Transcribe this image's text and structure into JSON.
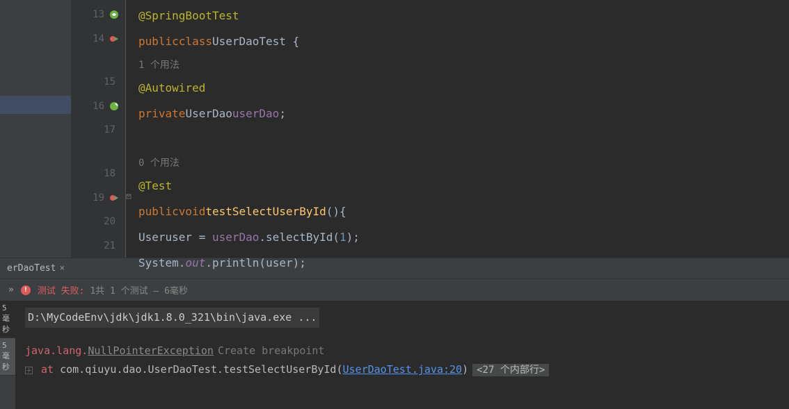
{
  "editor": {
    "lines": [
      {
        "num": "13",
        "icon": "spring"
      },
      {
        "num": "14",
        "icon": "run"
      },
      {
        "num": "15",
        "icon": ""
      },
      {
        "num": "16",
        "icon": "bean"
      },
      {
        "num": "17",
        "icon": ""
      },
      {
        "num": "18",
        "icon": ""
      },
      {
        "num": "19",
        "icon": "run"
      },
      {
        "num": "20",
        "icon": ""
      },
      {
        "num": "21",
        "icon": ""
      }
    ],
    "code": {
      "l13_annotation": "@SpringBootTest",
      "l14_public": "public",
      "l14_class": "class",
      "l14_name": "UserDaoTest",
      "l14_brace": " {",
      "l14a_hint": "1 个用法",
      "l15_annotation": "@Autowired",
      "l16_private": "private",
      "l16_type": "UserDao",
      "l16_field": "userDao",
      "l16_semi": ";",
      "l17a_hint": "0 个用法",
      "l18_annotation": "@Test",
      "l19_public": "public",
      "l19_void": "void",
      "l19_method": "testSelectUserById",
      "l19_parens": "(){",
      "l20_type": "User",
      "l20_var": "user",
      "l20_eq": " = ",
      "l20_field": "userDao",
      "l20_dot": ".",
      "l20_method": "selectById",
      "l20_open": "(",
      "l20_num": "1",
      "l20_close": ");",
      "l21_sys": "System",
      "l21_dot1": ".",
      "l21_out": "out",
      "l21_dot2": ".",
      "l21_println": "println",
      "l21_open": "(",
      "l21_var": "user",
      "l21_close": ");"
    }
  },
  "tab": {
    "name": "erDaoTest",
    "close": "×"
  },
  "status": {
    "chevron": "»",
    "error_label": "测试 失败:",
    "detail": "1共 1 个测试 – 6毫秒"
  },
  "time_tabs": {
    "t1": "5毫秒",
    "t2": "5毫秒"
  },
  "console": {
    "cmd": "D:\\MyCodeEnv\\jdk\\jdk1.8.0_321\\bin\\java.exe ...",
    "exception_pkg": "java.lang.",
    "exception_name": "NullPointerException",
    "breakpoint": "Create breakpoint",
    "at": "at",
    "stack_class": " com.qiuyu.dao.UserDaoTest.testSelectUserById",
    "stack_open": "(",
    "stack_link": "UserDaoTest.java:20",
    "stack_close": ")",
    "more": "<27 个内部行>",
    "expand": "+"
  }
}
